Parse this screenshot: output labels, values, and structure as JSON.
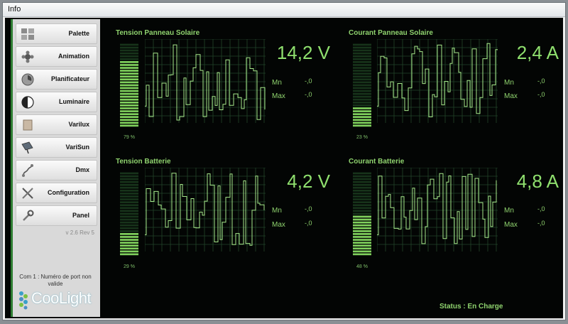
{
  "window": {
    "title": "Info"
  },
  "sidebar": {
    "items": [
      {
        "label": "Palette",
        "icon": "palette-grid-icon"
      },
      {
        "label": "Animation",
        "icon": "animation-icon"
      },
      {
        "label": "Planificateur",
        "icon": "scheduler-clock-icon"
      },
      {
        "label": "Luminaire",
        "icon": "luminaire-icon"
      },
      {
        "label": "Varilux",
        "icon": "varilux-icon"
      },
      {
        "label": "VariSun",
        "icon": "solar-panel-icon"
      },
      {
        "label": "Dmx",
        "icon": "dmx-icon"
      },
      {
        "label": "Configuration",
        "icon": "tools-icon"
      },
      {
        "label": "Panel",
        "icon": "wrench-icon"
      }
    ],
    "version": "v 2.6 Rev 5",
    "port_message": "Com 1 : Numéro de port non valide",
    "logo_text": "CooLight"
  },
  "panels": [
    {
      "title": "Tension Panneau Solaire",
      "value": "14,2 V",
      "level_label": "79 %",
      "level": 0.79,
      "min_label": "Mn",
      "min_value": "-,0",
      "max_label": "Max",
      "max_value": "-,0"
    },
    {
      "title": "Courant Panneau Solaire",
      "value": "2,4 A",
      "level_label": "23 %",
      "level": 0.23,
      "min_label": "Mn",
      "min_value": "-,0",
      "max_label": "Max",
      "max_value": "-,0"
    },
    {
      "title": "Tension Batterie",
      "value": "4,2 V",
      "level_label": "29 %",
      "level": 0.29,
      "min_label": "Mn",
      "min_value": "-,0",
      "max_label": "Max",
      "max_value": "-,0"
    },
    {
      "title": "Courant Batterie",
      "value": "4,8 A",
      "level_label": "48 %",
      "level": 0.48,
      "min_label": "Mn",
      "min_value": "-,0",
      "max_label": "Max",
      "max_value": "-,0"
    }
  ],
  "status": "Status : En Charge",
  "colors": {
    "accent_green": "#8fd36e",
    "background": "#030504",
    "sidebar_stripe": "#2e7d32"
  }
}
